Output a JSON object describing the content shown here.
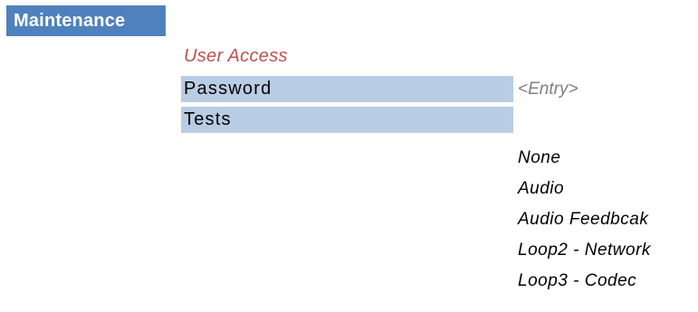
{
  "header": {
    "title": "Maintenance"
  },
  "section": {
    "title": "User Access"
  },
  "rows": {
    "password": {
      "label": "Password",
      "value_placeholder": "<Entry>"
    },
    "tests": {
      "label": "Tests",
      "options": [
        "None",
        "Audio",
        "Audio Feedbcak",
        "Loop2 - Network",
        "Loop3 - Codec"
      ]
    }
  },
  "colors": {
    "header_bg": "#4f81bd",
    "header_text": "#ffffff",
    "section_title": "#c0504d",
    "row_bg": "#b8cce4",
    "hint_text": "#808080"
  }
}
